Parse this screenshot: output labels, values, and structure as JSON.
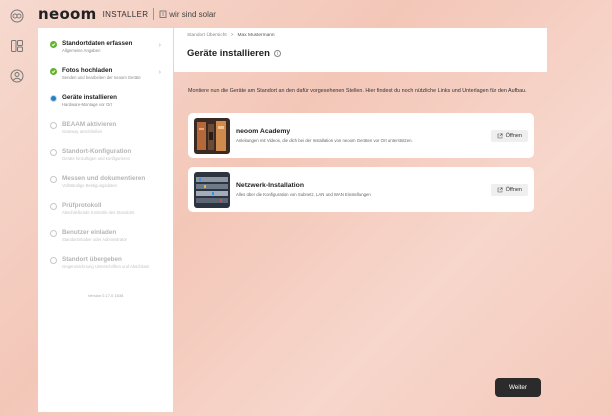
{
  "header": {
    "logo": "neoom",
    "app_label": "INSTALLER",
    "company": "wir sind solar"
  },
  "rail": {
    "icons": [
      "logo-mark-icon",
      "layout-grid-icon",
      "user-icon"
    ]
  },
  "steps": [
    {
      "title": "Standortdaten erfassen",
      "subtitle": "Allgemeine Angaben",
      "state": "done",
      "chevron": true
    },
    {
      "title": "Fotos hochladen",
      "subtitle": "Senden und bearbeiten der neoom Geräte",
      "state": "done",
      "chevron": true
    },
    {
      "title": "Geräte installieren",
      "subtitle": "Hardware-Montage vor Ort",
      "state": "active",
      "chevron": false
    },
    {
      "title": "BEAAM aktivieren",
      "subtitle": "Gateway anschließen",
      "state": "todo",
      "chevron": false
    },
    {
      "title": "Standort-Konfiguration",
      "subtitle": "Geräte hinzufügen und konfigurieren",
      "state": "todo",
      "chevron": false
    },
    {
      "title": "Messen und dokumentieren",
      "subtitle": "Vollständige Bestigungsdaten",
      "state": "todo",
      "chevron": false
    },
    {
      "title": "Prüfprotokoll",
      "subtitle": "Abschließende Kontrolle des Standorts",
      "state": "todo",
      "chevron": false
    },
    {
      "title": "Benutzer einladen",
      "subtitle": "Standortinhaber oder Administrator",
      "state": "todo",
      "chevron": false
    },
    {
      "title": "Standort übergeben",
      "subtitle": "Gegenzeichnung Unterschriften und Abschluss",
      "state": "todo",
      "chevron": false
    }
  ],
  "version": "Version 0.17.0 1638",
  "breadcrumb": {
    "parent": "Standort Übersicht",
    "separator": ">",
    "current": "Max Mustermann"
  },
  "page": {
    "title": "Geräte installieren",
    "info_icon": "i",
    "intro": "Montiere nun die Geräte am Standort an den dafür vorgesehenen Stellen. Hier findest du noch nützliche Links und Unterlagen für den Aufbau."
  },
  "cards": [
    {
      "title": "neoom Academy",
      "subtitle": "Anleitungen mit Videos, die dich bei der Installation von neoom Geräten vor Ort unterstützen.",
      "button": "Öffnen"
    },
    {
      "title": "Netzwerk-Installation",
      "subtitle": "Alles über die Konfiguration von Subnetz, LAN und WAN Einstellungen",
      "button": "Öffnen"
    }
  ],
  "footer": {
    "next_label": "Weiter"
  }
}
